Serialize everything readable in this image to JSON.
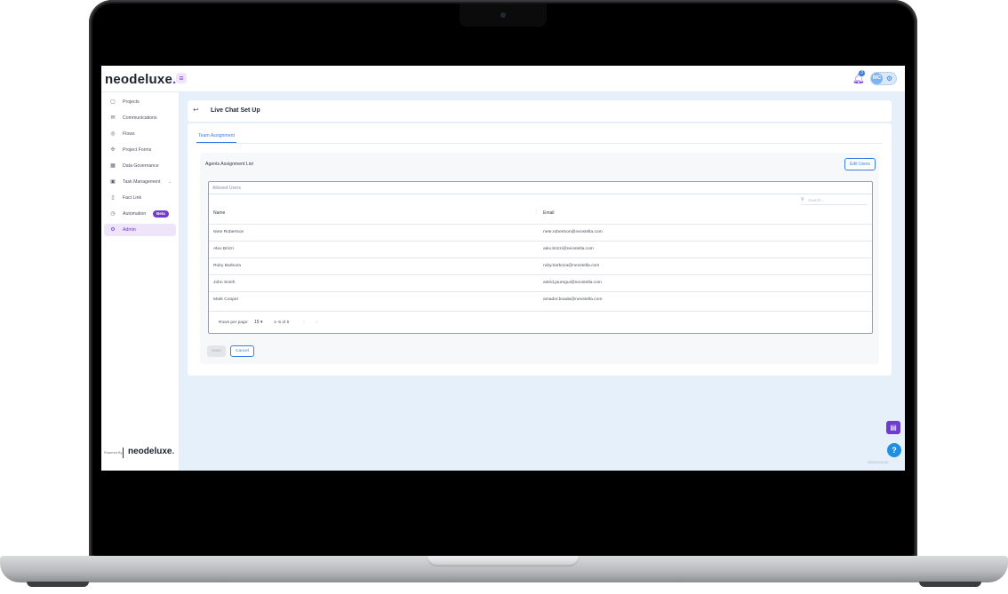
{
  "app": {
    "logo_text": "neodeluxe",
    "logo_dot": ".",
    "menu_icon": "hamburger-icon",
    "notification_count": "3",
    "user_initials": "MC",
    "version": "20250429133"
  },
  "sidebar": {
    "items": [
      {
        "label": "Projects",
        "icon": "clipboard-icon"
      },
      {
        "label": "Communications",
        "icon": "chat-icon"
      },
      {
        "label": "Flows",
        "icon": "flow-icon"
      },
      {
        "label": "Project Forms",
        "icon": "forms-icon"
      },
      {
        "label": "Data Governance",
        "icon": "grid-icon"
      },
      {
        "label": "Task Management",
        "icon": "tasks-icon"
      },
      {
        "label": "Fact Link",
        "icon": "document-icon"
      },
      {
        "label": "Automation",
        "icon": "automation-icon"
      },
      {
        "label": "Admin",
        "icon": "gear-icon"
      }
    ],
    "beta_badge": "Beta",
    "powered_by": "Powered By",
    "footer_logo": "neodeluxe"
  },
  "page": {
    "title": "Live Chat Set Up",
    "tab": "Team Assignment"
  },
  "assignment": {
    "title": "Agents Assignment List",
    "edit_users": "Edit Users",
    "allowed_label": "Allowed Users",
    "search_placeholder": "Search...",
    "columns": {
      "name": "Name",
      "email": "Email"
    },
    "rows": [
      {
        "name": "Nete Robertson",
        "email": "nete.robertson@neostella.com"
      },
      {
        "name": "Alex Brizzi",
        "email": "alex.brizzi@neostella.com"
      },
      {
        "name": "Ruby Barboza",
        "email": "ruby.barboza@neostella.com"
      },
      {
        "name": "John Smith",
        "email": "astrid.jauregui@neostella.com"
      },
      {
        "name": "Mark Cooper",
        "email": "amador.boada@neostella.com"
      }
    ],
    "pagination": {
      "rows_per_page_label": "Rows per page:",
      "rows_per_page": "15",
      "range": "1–5 of 5"
    },
    "save": "Save",
    "cancel": "Cancel"
  },
  "colors": {
    "accent": "#7b3fd2",
    "primary": "#3b7de0",
    "background": "#e5f0fa"
  }
}
